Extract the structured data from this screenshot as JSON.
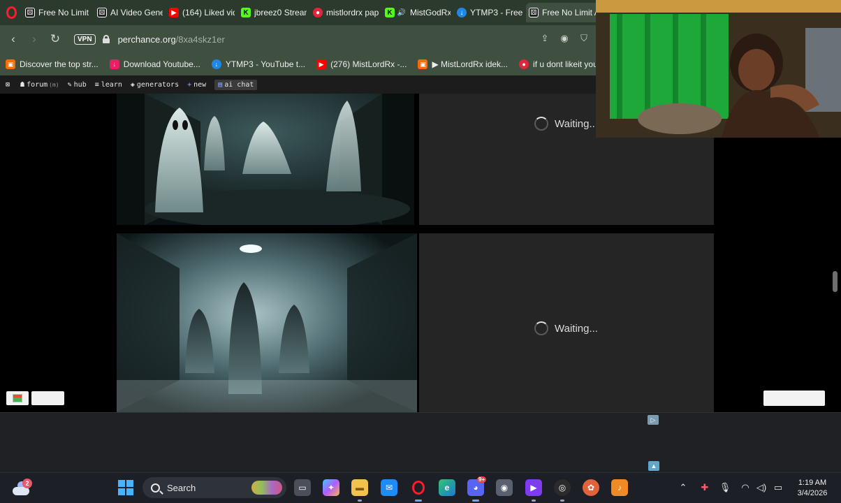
{
  "browser": {
    "tabs": [
      {
        "title": "Free No Limit A",
        "favicon_color": "#222222",
        "favicon_glyph": "dice-icon"
      },
      {
        "title": "AI Video Gener",
        "favicon_color": "#222222",
        "favicon_glyph": "dice-icon"
      },
      {
        "title": "(164) Liked vid",
        "favicon_color": "#ff0000",
        "favicon_glyph": "youtube-icon"
      },
      {
        "title": "jbreez0 Stream",
        "favicon_color": "#53fc18",
        "favicon_glyph": "kick-icon"
      },
      {
        "title": "mistlordrx pap",
        "favicon_color": "#e0263a",
        "favicon_glyph": "app-icon"
      },
      {
        "title": "MistGodRx",
        "favicon_color": "#53fc18",
        "favicon_glyph": "kick-icon"
      },
      {
        "title": "YTMP3 - Free Y",
        "favicon_color": "#1e88e5",
        "favicon_glyph": "ytmp3-icon"
      },
      {
        "title": "Free No Limit AI Image",
        "favicon_color": "#222222",
        "favicon_glyph": "dice-icon",
        "active": true
      }
    ],
    "vpn_label": "VPN",
    "url_host": "perchance.org",
    "url_path": "/8xa4skz1er",
    "bookmarks": [
      {
        "label": "Discover the top str...",
        "color": "#ff6a00"
      },
      {
        "label": "Download Youtube...",
        "color": "#e91e63"
      },
      {
        "label": "YTMP3 - YouTube t...",
        "color": "#1e88e5"
      },
      {
        "label": "(276) MistLordRx -...",
        "color": "#ff0000"
      },
      {
        "label": "▶ MistLordRx idek...",
        "color": "#ff6a00"
      },
      {
        "label": "if u dont likeit you b...",
        "color": "#e0263a"
      }
    ]
  },
  "perchance_nav": {
    "forum": "forum",
    "forum_count": "(m)",
    "hub": "hub",
    "learn": "learn",
    "generators": "generators",
    "new": "new",
    "ai_chat": "ai chat"
  },
  "results": {
    "waiting_text_1": "Waiting...",
    "waiting_text_2": "Waiting..."
  },
  "taskbar": {
    "weather_badge": "2",
    "search_placeholder": "Search",
    "time": "1:19 AM",
    "date": "3/4/2026",
    "discord_badge": "9+",
    "accent": "#62a8ff"
  }
}
